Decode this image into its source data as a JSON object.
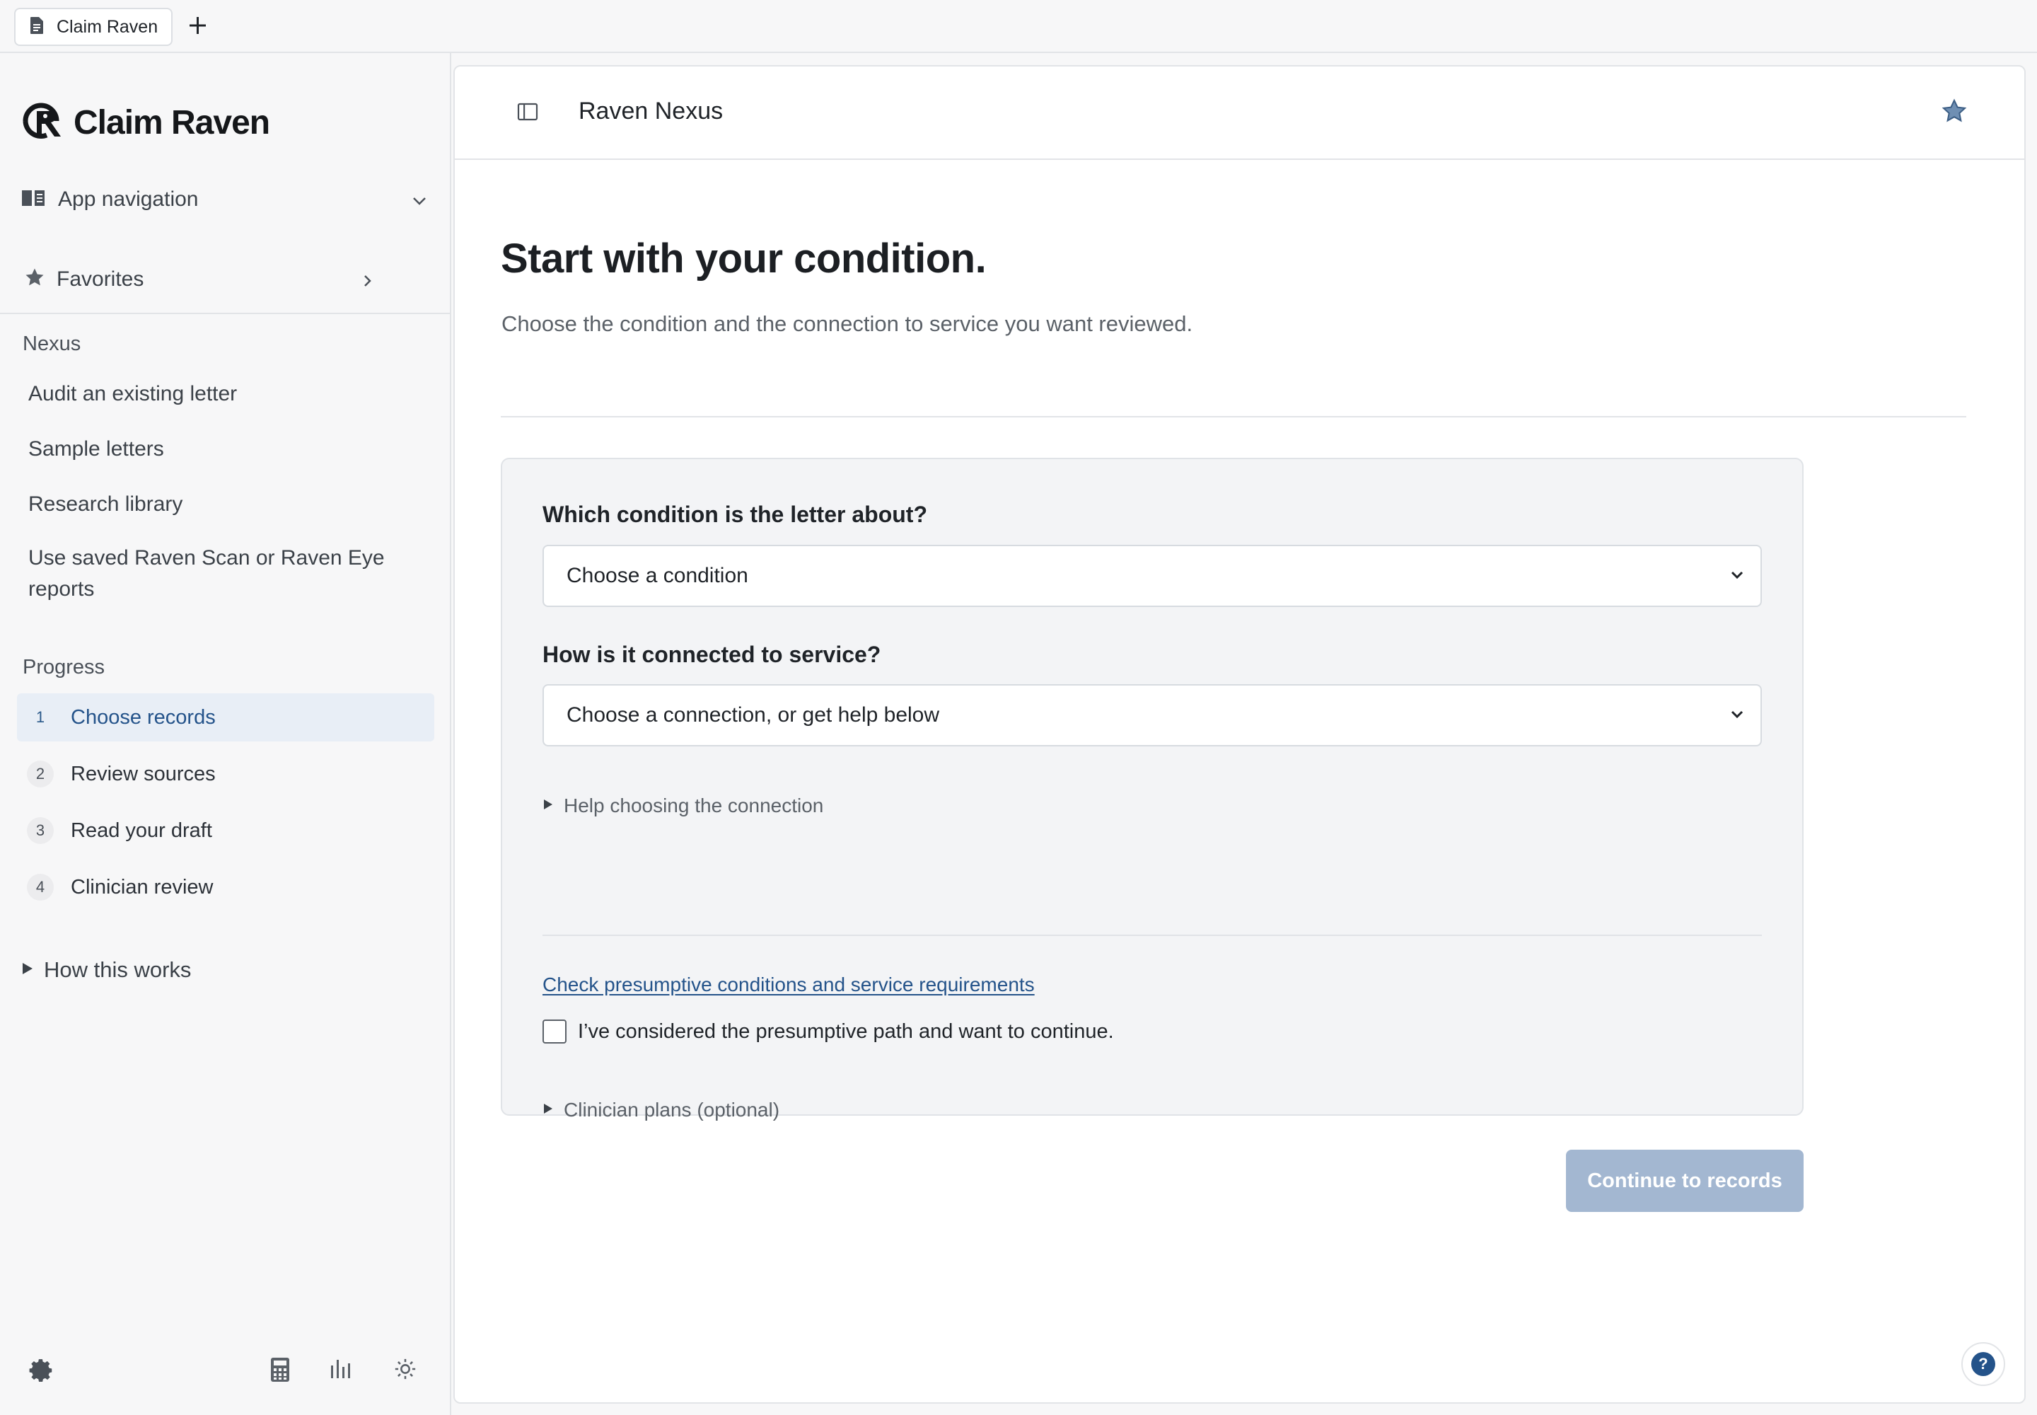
{
  "browser": {
    "tab_title": "Claim Raven",
    "new_tab_icon": "plus-icon"
  },
  "sidebar": {
    "logo_text": "Claim Raven",
    "app_navigation_label": "App navigation",
    "favorites_label": "Favorites",
    "nexus_heading": "Nexus",
    "links": [
      "Audit an existing letter",
      "Sample letters",
      "Research library",
      "Use saved Raven Scan or Raven Eye reports"
    ],
    "progress_heading": "Progress",
    "steps": [
      {
        "num": "1",
        "label": "Choose records",
        "active": true
      },
      {
        "num": "2",
        "label": "Review sources",
        "active": false
      },
      {
        "num": "3",
        "label": "Read your draft",
        "active": false
      },
      {
        "num": "4",
        "label": "Clinician review",
        "active": false
      }
    ],
    "how_label": "How this works",
    "bottom_icons": [
      "gear-icon",
      "calculator-icon",
      "chart-icon",
      "sun-icon"
    ]
  },
  "main": {
    "header_title": "Raven Nexus",
    "page_title": "Start with your condition.",
    "page_subtitle": "Choose the condition and the connection to service you want reviewed.",
    "form": {
      "condition_question": "Which condition is the letter about?",
      "condition_value": "Choose a condition",
      "connection_question": "How is it connected to service?",
      "connection_value": "Choose a connection, or get help below",
      "help_disclosure": "Help choosing the connection",
      "presumptive_link": "Check presumptive conditions and service requirements",
      "presumptive_checkbox_label": "I’ve considered the presumptive path and want to continue.",
      "clinician_disclosure": "Clinician plans (optional)"
    },
    "continue_label": "Continue to records",
    "help_label": "?"
  },
  "colors": {
    "accent": "#24538a",
    "active_step_bg": "#e8eef6",
    "button_disabled": "#a3b7d1",
    "card_bg": "#f3f4f6"
  }
}
